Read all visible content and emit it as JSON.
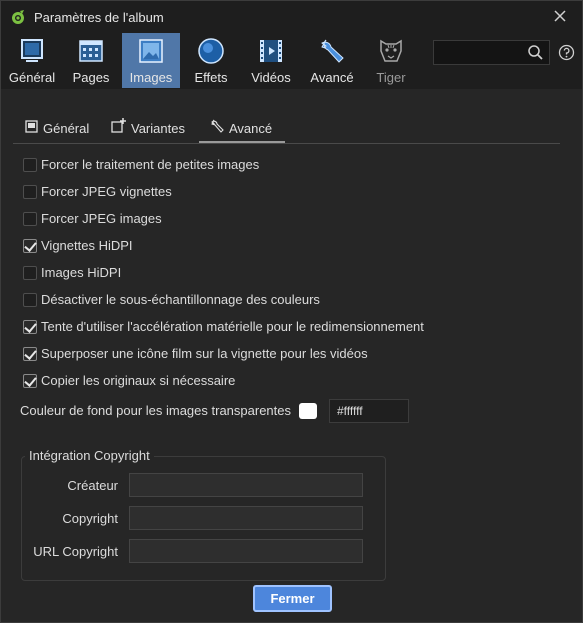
{
  "window": {
    "title": "Paramètres de l'album"
  },
  "toolbar": {
    "tabs": [
      {
        "label": "Général",
        "icon": "monitor-icon"
      },
      {
        "label": "Pages",
        "icon": "pages-grid-icon"
      },
      {
        "label": "Images",
        "icon": "image-icon"
      },
      {
        "label": "Effets",
        "icon": "circle-effects-icon"
      },
      {
        "label": "Vidéos",
        "icon": "film-icon"
      },
      {
        "label": "Avancé",
        "icon": "wrench-icon"
      },
      {
        "label": "Tiger",
        "icon": "tiger-icon"
      }
    ],
    "active_tab": "Images",
    "search_placeholder": ""
  },
  "subtabs": [
    {
      "label": "Général",
      "icon": "square-icon"
    },
    {
      "label": "Variantes",
      "icon": "variants-icon"
    },
    {
      "label": "Avancé",
      "icon": "wrench-icon"
    }
  ],
  "active_subtab": "Avancé",
  "options": [
    {
      "label": "Forcer le traitement de petites images",
      "checked": false
    },
    {
      "label": "Forcer JPEG vignettes",
      "checked": false
    },
    {
      "label": "Forcer JPEG images",
      "checked": false
    },
    {
      "label": "Vignettes HiDPI",
      "checked": true
    },
    {
      "label": "Images HiDPI",
      "checked": false
    },
    {
      "label": "Désactiver le sous-échantillonnage des couleurs",
      "checked": false
    },
    {
      "label": "Tente d'utiliser l'accélération matérielle pour le redimensionnement",
      "checked": true
    },
    {
      "label": "Superposer une icône film sur la vignette pour les vidéos",
      "checked": true
    },
    {
      "label": "Copier les originaux si nécessaire",
      "checked": true
    }
  ],
  "background": {
    "label": "Couleur de fond pour les images transparentes",
    "color_value": "#ffffff",
    "swatch_color": "#ffffff"
  },
  "copyright": {
    "title": "Intégration Copyright",
    "fields": [
      {
        "label": "Créateur",
        "value": ""
      },
      {
        "label": "Copyright",
        "value": ""
      },
      {
        "label": "URL Copyright",
        "value": ""
      }
    ]
  },
  "buttons": {
    "close_label": "Fermer"
  },
  "colors": {
    "accent": "#5077a8",
    "button": "#4d86dc",
    "background": "#262626"
  }
}
